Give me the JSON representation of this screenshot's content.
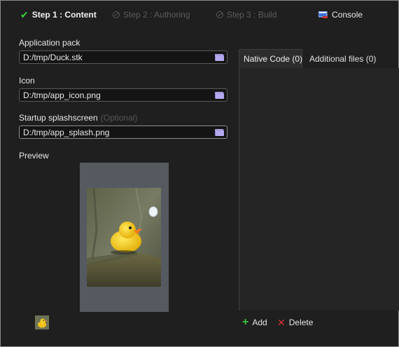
{
  "steps": [
    {
      "label": "Step 1 : Content",
      "state": "active"
    },
    {
      "label": "Step 2 : Authoring",
      "state": "disabled"
    },
    {
      "label": "Step 3 : Build",
      "state": "disabled"
    }
  ],
  "console_label": "Console",
  "form": {
    "app_pack": {
      "label": "Application pack",
      "value": "D:/tmp/Duck.stk"
    },
    "icon": {
      "label": "Icon",
      "value": "D:/tmp/app_icon.png"
    },
    "splash": {
      "label": "Startup splashscreen",
      "optional": "(Optional)",
      "value": "D:/tmp/app_splash.png"
    },
    "preview_label": "Preview"
  },
  "tabs": [
    {
      "label": "Native Code (0)",
      "active": true
    },
    {
      "label": "Additional files (0)",
      "active": false
    }
  ],
  "actions": {
    "add_label": "Add",
    "delete_label": "Delete"
  },
  "colors": {
    "accent_check": "#35d035",
    "add": "#3cc43c",
    "delete": "#e03030",
    "folder": "#b4aaf0"
  }
}
